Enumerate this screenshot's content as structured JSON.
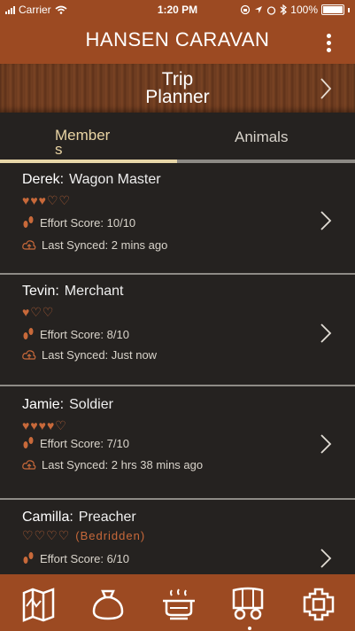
{
  "status_bar": {
    "carrier": "Carrier",
    "time": "1:20 PM",
    "battery": "100%"
  },
  "app": {
    "title": "HANSEN CARAVAN"
  },
  "planner": {
    "label_line1": "Trip",
    "label_line2": "Planner"
  },
  "tabs": {
    "members_label_line1": "Member",
    "members_label_line2": "s",
    "animals_label": "Animals",
    "selected": "Members"
  },
  "members": [
    {
      "name": "Derek:",
      "role": "Wagon Master",
      "hearts_filled": 3,
      "hearts_total": 5,
      "note": "",
      "effort": "Effort Score: 10/10",
      "synced": "Last Synced: 2 mins ago"
    },
    {
      "name": "Tevin:",
      "role": "Merchant",
      "hearts_filled": 1,
      "hearts_total": 3,
      "note": "",
      "effort": "Effort Score: 8/10",
      "synced": "Last Synced: Just now"
    },
    {
      "name": "Jamie:",
      "role": "Soldier",
      "hearts_filled": 4,
      "hearts_total": 5,
      "note": "",
      "effort": "Effort Score: 7/10",
      "synced": "Last Synced: 2 hrs 38 mins ago"
    },
    {
      "name": "Camilla:",
      "role": "Preacher",
      "hearts_filled": 0,
      "hearts_total": 4,
      "note": "(Bedridden)",
      "effort": "Effort Score: 6/10",
      "synced": ""
    }
  ],
  "bottom_nav": [
    {
      "icon": "map-icon"
    },
    {
      "icon": "supplies-bag-icon"
    },
    {
      "icon": "campfire-pot-icon"
    },
    {
      "icon": "wagon-icon",
      "selected": true
    },
    {
      "icon": "settings-gear-icon"
    }
  ],
  "colors": {
    "header": "#9c4a22",
    "background": "#252220",
    "accent": "#c8693a",
    "tab_indicator": "#e7d6a8"
  }
}
